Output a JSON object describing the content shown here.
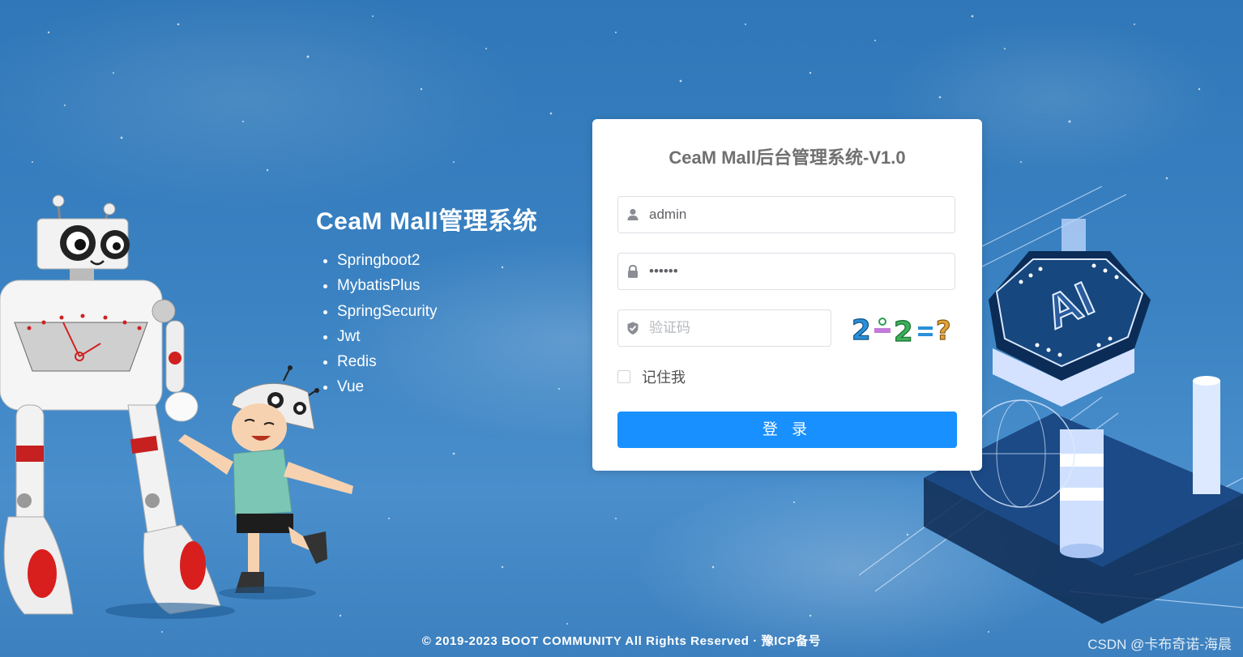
{
  "intro": {
    "title": "CeaM Mall管理系统",
    "features": [
      "Springboot2",
      "MybatisPlus",
      "SpringSecurity",
      "Jwt",
      "Redis",
      "Vue"
    ]
  },
  "login": {
    "title": "CeaM Mall后台管理系统-V1.0",
    "username_value": "admin",
    "password_value": "••••••",
    "captcha_placeholder": "验证码",
    "captcha_image_text": "2-2=?",
    "remember_label": "记住我",
    "remember_checked": false,
    "submit_label": "登 录"
  },
  "footer": {
    "text": "© 2019-2023 BOOT COMMUNITY All Rights Reserved · 豫ICP备号"
  },
  "watermark": "CSDN @卡布奇诺-海晨",
  "colors": {
    "background": "#3a82c2",
    "primary_button": "#1890ff",
    "card": "#ffffff"
  },
  "icons": {
    "username": "user-icon",
    "password": "lock-icon",
    "captcha": "shield-check-icon"
  }
}
